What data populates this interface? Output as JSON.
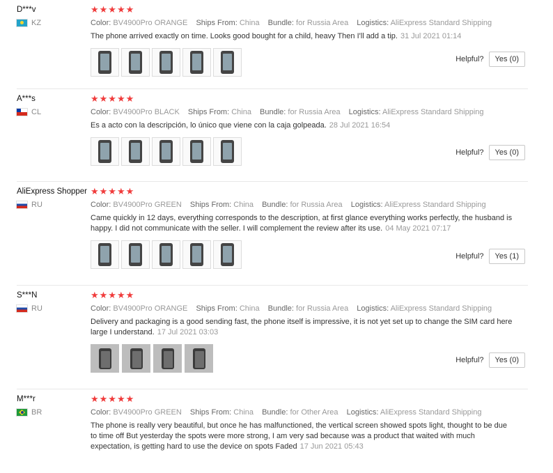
{
  "labels": {
    "color": "Color:",
    "ships_from": "Ships From:",
    "bundle": "Bundle:",
    "logistics": "Logistics:",
    "helpful": "Helpful?"
  },
  "rating_stars": "★★★★★",
  "reviews": [
    {
      "user": "D***v",
      "country": "KZ",
      "flag": "kazakhstan-flag-icon",
      "rating": 5,
      "color": "BV4900Pro ORANGE",
      "ships_from": "China",
      "bundle": "for Russia Area",
      "logistics": "AliExpress Standard Shipping",
      "text": "The phone arrived exactly on time. Looks good bought for a child, heavy Then I'll add a tip.",
      "date": "31 Jul 2021 01:14",
      "photos": 5,
      "yes": "Yes (0)"
    },
    {
      "user": "A***s",
      "country": "CL",
      "flag": "chile-flag-icon",
      "rating": 5,
      "color": "BV4900Pro BLACK",
      "ships_from": "China",
      "bundle": "for Russia Area",
      "logistics": "AliExpress Standard Shipping",
      "text": "Es a acto con la descripción, lo único que viene con la caja golpeada.",
      "date": "28 Jul 2021 16:54",
      "photos": 5,
      "yes": "Yes (0)"
    },
    {
      "user": "AliExpress Shopper",
      "country": "RU",
      "flag": "russia-flag-icon",
      "rating": 5,
      "color": "BV4900Pro GREEN",
      "ships_from": "China",
      "bundle": "for Russia Area",
      "logistics": "AliExpress Standard Shipping",
      "text": "Came quickly in 12 days, everything corresponds to the description, at first glance everything works perfectly, the husband is happy. I did not communicate with the seller. I will complement the review after its use.",
      "date": "04 May 2021 07:17",
      "photos": 5,
      "yes": "Yes (1)"
    },
    {
      "user": "S***N",
      "country": "RU",
      "flag": "russia-flag-icon",
      "rating": 5,
      "color": "BV4900Pro ORANGE",
      "ships_from": "China",
      "bundle": "for Russia Area",
      "logistics": "AliExpress Standard Shipping",
      "text": "Delivery and packaging is a good sending fast, the phone itself is impressive, it is not yet set up to change the SIM card here large I understand.",
      "date": "17 Jul 2021 03:03",
      "photos": 4,
      "yes": "Yes (0)"
    },
    {
      "user": "M***r",
      "country": "BR",
      "flag": "brazil-flag-icon",
      "rating": 5,
      "color": "BV4900Pro GREEN",
      "ships_from": "China",
      "bundle": "for Other Area",
      "logistics": "AliExpress Standard Shipping",
      "text": "The phone is really very beautiful, but once he has malfunctioned, the vertical screen showed spots light, thought to be due to time off But yesterday the spots were more strong, I am very sad because was a product that waited with much expectation, is getting hard to use the device on spots Faded",
      "date": "17 Jun 2021 05:43",
      "photos": 0,
      "yes": ""
    }
  ]
}
